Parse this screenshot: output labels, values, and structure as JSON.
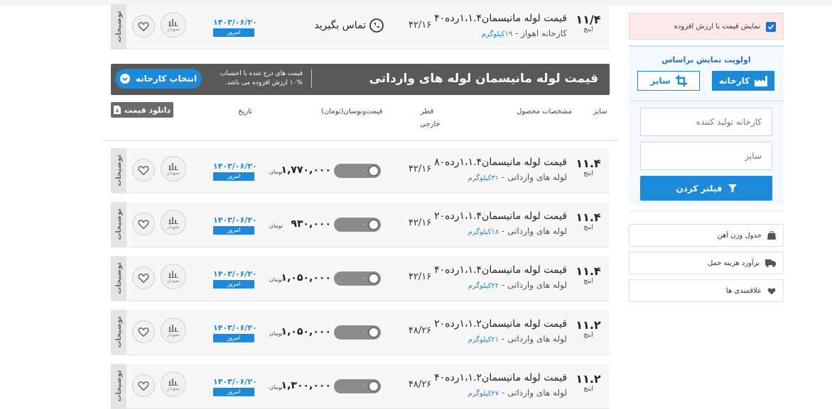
{
  "table_header": {
    "title": "قیمت لوله مانیسمان لوله های وارداتی",
    "note_line1": "قیمت های درج شده با احتساب",
    "note_line2": "۱۰% ارزش افزوده می باشد.",
    "factory_button": "انتخاب کارخانه",
    "download_button": "دانلود قیمت",
    "columns": {
      "size": "سایز",
      "spec": "مشخصات محصول",
      "diameter_line1": "قطر",
      "diameter_line2": "خارجی",
      "price": "قیمت‌ونوسان(تومان)",
      "date": "تاریخ"
    }
  },
  "top_row": {
    "size": "۱۱/۴",
    "unit": "اینچ",
    "name": "قیمت لوله مانیسمان۱،۱.۴رده۴۰",
    "factory": "کارخانه اهواز",
    "weight": "۱۹کیلوگرم",
    "diameter": "۴۲/۱۶",
    "contact": "تماس بگیرید",
    "date": "۱۴۰۳/۰۶/۲۰",
    "today": "امروز",
    "chart": "نمودار",
    "desc_tab": "توضیحات"
  },
  "rows": [
    {
      "size": "۱۱.۴",
      "unit": "اینچ",
      "name": "قیمت لوله مانیسمان۱،۱.۴رده۸۰",
      "factory": "لوله های وارداتی",
      "weight": "۳۱کیلوگرم",
      "diameter": "۴۲/۱۶",
      "price": "۱,۷۷۰,۰۰۰",
      "currency": "تومان",
      "change": "۰",
      "date": "۱۴۰۳/۰۶/۲۰",
      "today": "امروز",
      "chart": "نمودار",
      "desc_tab": "توضیحات"
    },
    {
      "size": "۱۱.۴",
      "unit": "اینچ",
      "name": "قیمت لوله مانیسمان۱،۱.۴رده۲۰",
      "factory": "لوله های وارداتی",
      "weight": "۱۸کیلوگرم",
      "diameter": "۴۲/۱۶",
      "price": "۹۳۰,۰۰۰",
      "currency": "تومان",
      "change": "۰",
      "date": "۱۴۰۳/۰۶/۲۰",
      "today": "امروز",
      "chart": "نمودار",
      "desc_tab": "توضیحات"
    },
    {
      "size": "۱۱.۴",
      "unit": "اینچ",
      "name": "قیمت لوله مانیسمان۱،۱.۴رده۴۰",
      "factory": "لوله های وارداتی",
      "weight": "۲۲کیلوگرم",
      "diameter": "۴۲/۱۶",
      "price": "۱,۰۵۰,۰۰۰",
      "currency": "تومان",
      "change": "۰",
      "date": "۱۴۰۳/۰۶/۲۰",
      "today": "امروز",
      "chart": "نمودار",
      "desc_tab": "توضیحات"
    },
    {
      "size": "۱۱.۲",
      "unit": "اینچ",
      "name": "قیمت لوله مانیسمان۱،۱.۲رده۲۰",
      "factory": "لوله های وارداتی",
      "weight": "۲۱کیلوگرم",
      "diameter": "۴۸/۲۶",
      "price": "۱,۰۵۰,۰۰۰",
      "currency": "تومان",
      "change": "۰",
      "date": "۱۴۰۳/۰۶/۲۰",
      "today": "امروز",
      "chart": "نمودار",
      "desc_tab": "توضیحات"
    },
    {
      "size": "۱۱.۲",
      "unit": "اینچ",
      "name": "قیمت لوله مانیسمان۱،۱.۲رده۴۰",
      "factory": "لوله های وارداتی",
      "weight": "۲۷کیلوگرم",
      "diameter": "۴۸/۲۶",
      "price": "۱,۳۰۰,۰۰۰",
      "currency": "تومان",
      "change": "۰",
      "date": "۱۴۰۳/۰۶/۲۰",
      "today": "امروز",
      "chart": "نمودار",
      "desc_tab": "توضیحات"
    }
  ],
  "sidebar": {
    "vat_label": "نمایش قیمت با ارزش افزوده",
    "vat_checked": true,
    "priority_title": "اولویت نمایش براساس",
    "by_factory": "کارخانه",
    "by_size": "سایز",
    "factory_placeholder": "کارخانه تولید کننده",
    "size_placeholder": "سایز",
    "filter_button": "فیلتر کردن",
    "links": [
      {
        "label": "جدول وزن آهن",
        "icon": "weight-icon"
      },
      {
        "label": "برآورد هزینه حمل",
        "icon": "truck-icon"
      },
      {
        "label": "علاقمندی ها",
        "icon": "heart-icon"
      }
    ]
  },
  "colors": {
    "accent": "#1d8ad9",
    "banner": "#585858",
    "row_bg": "#f7f7f7",
    "vat_bg": "#fbe9ea"
  }
}
